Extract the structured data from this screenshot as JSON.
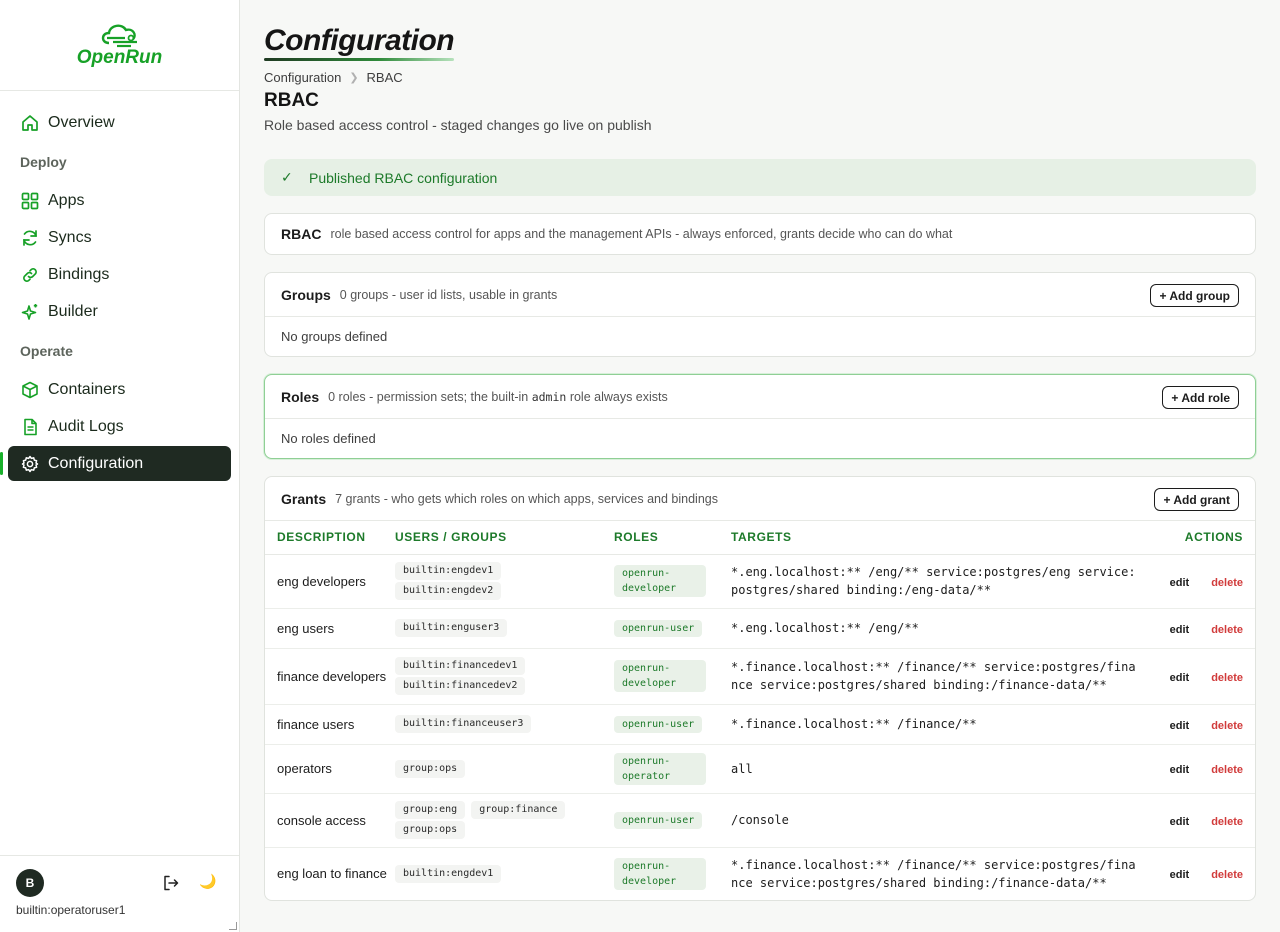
{
  "brand": {
    "name": "OpenRun"
  },
  "sidebar": {
    "items": [
      {
        "label": "Overview",
        "icon": "home-icon"
      },
      {
        "section": "Deploy"
      },
      {
        "label": "Apps",
        "icon": "grid-icon"
      },
      {
        "label": "Syncs",
        "icon": "refresh-icon"
      },
      {
        "label": "Bindings",
        "icon": "link-icon"
      },
      {
        "label": "Builder",
        "icon": "sparkle-icon"
      },
      {
        "section": "Operate"
      },
      {
        "label": "Containers",
        "icon": "cube-icon"
      },
      {
        "label": "Audit Logs",
        "icon": "document-icon"
      },
      {
        "label": "Configuration",
        "icon": "gear-icon",
        "active": true
      }
    ],
    "footer": {
      "avatar_letter": "B",
      "username": "builtin:operatoruser1"
    }
  },
  "page": {
    "title": "Configuration",
    "breadcrumb": [
      "Configuration",
      "RBAC"
    ],
    "section_title": "RBAC",
    "subtitle": "Role based access control - staged changes go live on publish"
  },
  "alert": {
    "message": "Published RBAC configuration"
  },
  "rbac_card": {
    "title": "RBAC",
    "description": "role based access control for apps and the management APIs - always enforced, grants decide who can do what"
  },
  "groups_card": {
    "title": "Groups",
    "description": "0 groups - user id lists, usable in grants",
    "add_label": "+ Add group",
    "empty": "No groups defined"
  },
  "roles_card": {
    "title": "Roles",
    "description_pre": "0 roles - permission sets; the built-in",
    "description_code": "admin",
    "description_post": "role always exists",
    "add_label": "+ Add role",
    "empty": "No roles defined"
  },
  "grants_card": {
    "title": "Grants",
    "description": "7 grants - who gets which roles on which apps, services and bindings",
    "add_label": "+ Add grant",
    "columns": [
      "DESCRIPTION",
      "USERS / GROUPS",
      "ROLES",
      "TARGETS",
      "ACTIONS"
    ],
    "edit_label": "edit",
    "delete_label": "delete",
    "rows": [
      {
        "description": "eng developers",
        "users": [
          "builtin:engdev1",
          "builtin:engdev2"
        ],
        "role": "openrun-developer",
        "targets": "*.eng.localhost:** /eng/** service:postgres/eng service:postgres/shared binding:/eng-data/**"
      },
      {
        "description": "eng users",
        "users": [
          "builtin:enguser3"
        ],
        "role": "openrun-user",
        "targets": "*.eng.localhost:** /eng/**"
      },
      {
        "description": "finance developers",
        "users": [
          "builtin:financedev1",
          "builtin:financedev2"
        ],
        "role": "openrun-developer",
        "targets": "*.finance.localhost:** /finance/** service:postgres/finance service:postgres/shared binding:/finance-data/**"
      },
      {
        "description": "finance users",
        "users": [
          "builtin:financeuser3"
        ],
        "role": "openrun-user",
        "targets": "*.finance.localhost:** /finance/**"
      },
      {
        "description": "operators",
        "users": [
          "group:ops"
        ],
        "role": "openrun-operator",
        "targets": "all"
      },
      {
        "description": "console access",
        "users": [
          "group:eng",
          "group:finance",
          "group:ops"
        ],
        "role": "openrun-user",
        "targets": "/console"
      },
      {
        "description": "eng loan to finance",
        "users": [
          "builtin:engdev1"
        ],
        "role": "openrun-developer",
        "targets": "*.finance.localhost:** /finance/** service:postgres/finance service:postgres/shared binding:/finance-data/**"
      }
    ]
  },
  "colors": {
    "accent": "#19b02b",
    "active_bg": "#1f2a22",
    "danger": "#d13b3b",
    "success_bg": "#e6f0e5"
  }
}
